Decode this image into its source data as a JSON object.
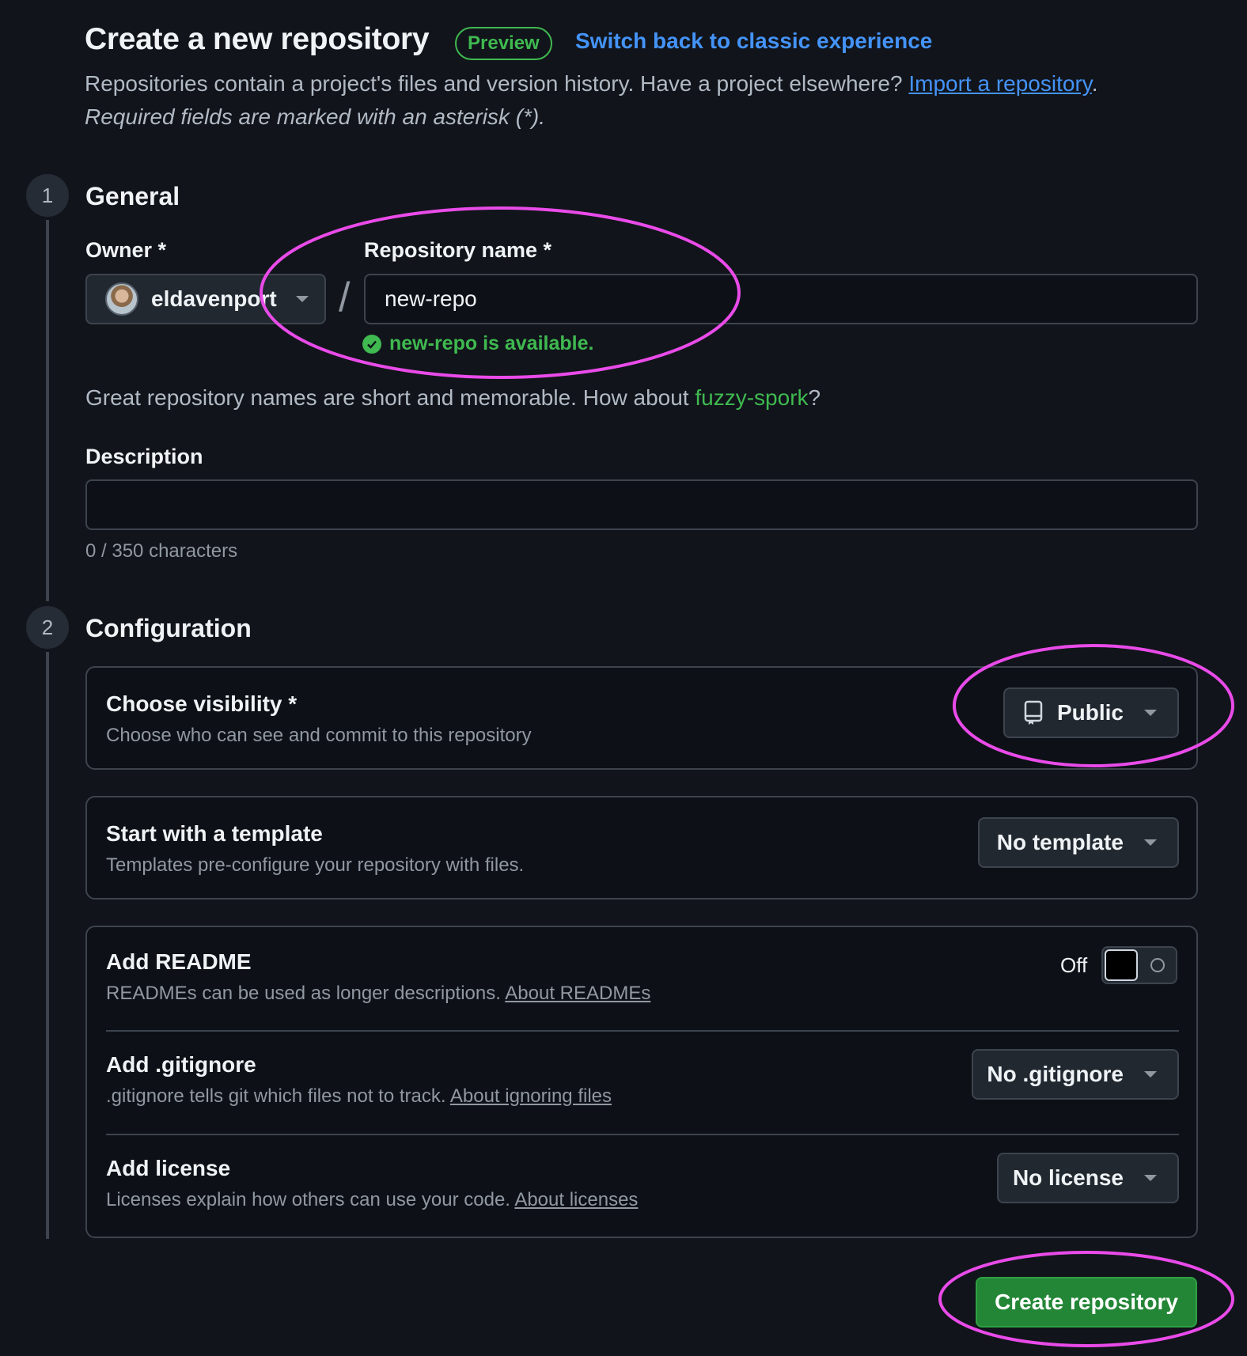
{
  "header": {
    "title": "Create a new repository",
    "badge": "Preview",
    "switch_link": "Switch back to classic experience",
    "intro_text": "Repositories contain a project's files and version history. Have a project elsewhere?",
    "import_link": "Import a repository",
    "intro_end": ".",
    "required_note": "Required fields are marked with an asterisk (*)."
  },
  "general": {
    "step_number": "1",
    "title": "General",
    "owner_label": "Owner *",
    "owner_value": "eldavenport",
    "separator": "/",
    "repo_name_label": "Repository name *",
    "repo_name_value": "new-repo",
    "availability": "new-repo is available.",
    "hint_prefix": "Great repository names are short and memorable. How about ",
    "hint_suggestion": "fuzzy-spork",
    "hint_suffix": "?",
    "description_label": "Description",
    "description_value": "",
    "char_count": "0 / 350 characters"
  },
  "configuration": {
    "step_number": "2",
    "title": "Configuration",
    "visibility": {
      "title": "Choose visibility *",
      "desc": "Choose who can see and commit to this repository",
      "value": "Public"
    },
    "template": {
      "title": "Start with a template",
      "desc": "Templates pre-configure your repository with files.",
      "value": "No template"
    },
    "readme": {
      "title": "Add README",
      "desc": "READMEs can be used as longer descriptions.",
      "link": "About READMEs",
      "toggle_state": "Off"
    },
    "gitignore": {
      "title": "Add .gitignore",
      "desc": ".gitignore tells git which files not to track.",
      "link": "About ignoring files",
      "value": "No .gitignore"
    },
    "license": {
      "title": "Add license",
      "desc": "Licenses explain how others can use your code.",
      "link": "About licenses",
      "value": "No license"
    }
  },
  "actions": {
    "create_label": "Create repository"
  },
  "colors": {
    "background": "#11141a",
    "accent_link": "#4493f8",
    "success": "#3fb950",
    "primary_button": "#238636",
    "annotation": "#e94be9"
  }
}
